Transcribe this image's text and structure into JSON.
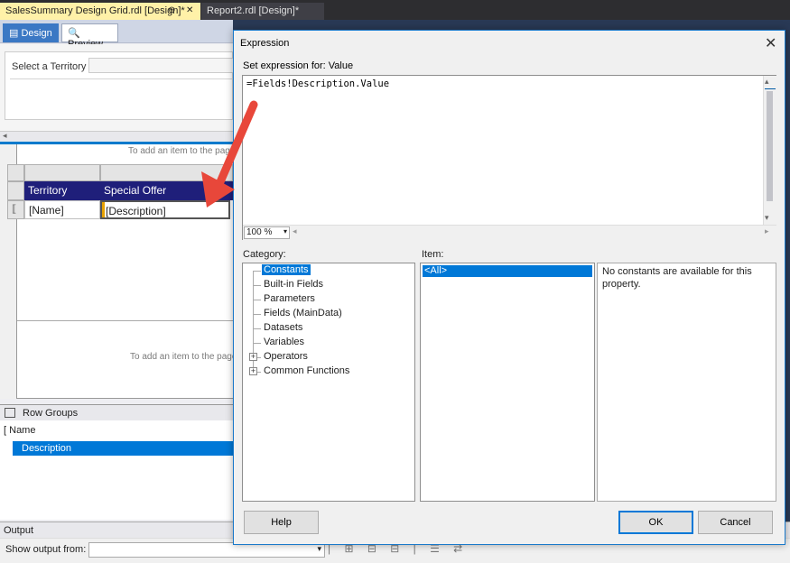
{
  "tabs": [
    {
      "label": "SalesSummary Design Grid.rdl [Design]*",
      "pin": "⊕",
      "close": "✕"
    },
    {
      "label": "Report2.rdl [Design]*"
    }
  ],
  "view_buttons": {
    "design": "Design",
    "preview": "Preview"
  },
  "parameters": {
    "territory_label": "Select a Territory"
  },
  "design_surface": {
    "hint_top": "To add an item to the pag",
    "hint_bottom": "To add an item to the page"
  },
  "tablix": {
    "headers": [
      "Territory",
      "Special Offer"
    ],
    "cells": [
      "[Name]",
      "[Description]"
    ]
  },
  "row_groups": {
    "title": "Row Groups",
    "items": [
      "Name",
      "Description"
    ]
  },
  "output": {
    "title": "Output",
    "show_from_label": "Show output from:"
  },
  "dialog": {
    "title": "Expression",
    "close": "✕",
    "set_expression_label": "Set expression for: Value",
    "expression": "=Fields!Description.Value",
    "zoom": "100 %",
    "category_label": "Category:",
    "item_label": "Item:",
    "categories": [
      {
        "label": "Constants",
        "expandable": false,
        "selected": true
      },
      {
        "label": "Built-in Fields",
        "expandable": false
      },
      {
        "label": "Parameters",
        "expandable": false
      },
      {
        "label": "Fields (MainData)",
        "expandable": false
      },
      {
        "label": "Datasets",
        "expandable": false
      },
      {
        "label": "Variables",
        "expandable": false
      },
      {
        "label": "Operators",
        "expandable": true
      },
      {
        "label": "Common Functions",
        "expandable": true
      }
    ],
    "items": [
      "<All>"
    ],
    "description": "No constants are available for this property.",
    "buttons": {
      "help": "Help",
      "ok": "OK",
      "cancel": "Cancel"
    }
  },
  "colors": {
    "accent": "#0078d7",
    "header_fill": "#1f1f7a",
    "arrow": "#e8473a",
    "active_tab": "#fff1a8"
  }
}
